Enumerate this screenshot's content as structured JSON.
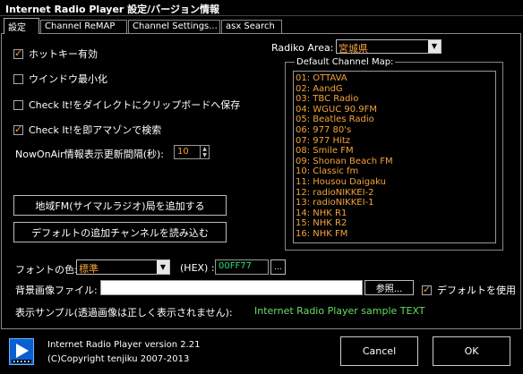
{
  "window": {
    "title": "Internet Radio Player 設定/バージョン情報"
  },
  "tabs": [
    {
      "label": "設定",
      "active": true
    },
    {
      "label": "Channel ReMAP",
      "active": false
    },
    {
      "label": "Channel Settings...",
      "active": false
    },
    {
      "label": "asx Search",
      "active": false
    }
  ],
  "settings": {
    "hotkey": {
      "label": "ホットキー有効",
      "checked": true
    },
    "minimize": {
      "label": "ウインドウ最小化",
      "checked": false
    },
    "clipboard": {
      "label": "Check It!をダイレクトにクリップボードへ保存",
      "checked": false
    },
    "amazon": {
      "label": "Check It!を即アマゾンで検索",
      "checked": true
    },
    "nowonair_label": "NowOnAir情報表示更新間隔(秒):",
    "nowonair_value": "10"
  },
  "buttons": {
    "add_local_fm": "地域FM(サイマルラジオ)局を追加する",
    "load_default": "デフォルトの追加チャンネルを読み込む",
    "references": "参照...",
    "ellipsis": "...",
    "cancel": "Cancel",
    "ok": "OK"
  },
  "radiko": {
    "area_label": "Radiko Area:",
    "area_value": "宮城県",
    "map_label": "Default Channel Map:",
    "channels": [
      "01: OTTAVA",
      "02: AandG",
      "03: TBC Radio",
      "04: WGUC 90.9FM",
      "05: Beatles Radio",
      "06: 977 80's",
      "07: 977 Hitz",
      "08: Smile FM",
      "09: Shonan Beach FM",
      "10: Classic fm",
      "11: Housou Daigaku",
      "12: radioNIKKEI-2",
      "13: radioNIKKEI-1",
      "14: NHK R1",
      "15: NHK R2",
      "16: NHK FM"
    ]
  },
  "font_color": {
    "label": "フォントの色:",
    "value": "標準",
    "hex_label": "(HEX) :",
    "hex_value": "00FF77"
  },
  "background": {
    "label": "背景画像ファイル:",
    "path": "",
    "use_default_label": "デフォルトを使用",
    "use_default_checked": true
  },
  "sample": {
    "label": "表示サンプル(透過画像は正しく表示されません):",
    "text": "Internet Radio Player sample TEXT"
  },
  "footer": {
    "version": "Internet Radio Player version 2.21",
    "copyright": "(C)Copyright tenjiku 2007-2013"
  },
  "colors": {
    "accent": "#f5a23b",
    "sample_green": "#66dd66",
    "selection": "#0a63c8"
  }
}
